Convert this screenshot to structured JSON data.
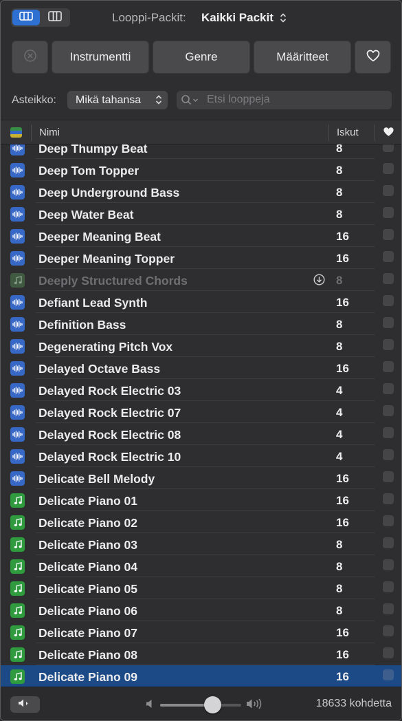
{
  "header": {
    "pack_label": "Looppi-Packit:",
    "pack_value": "Kaikki Packit"
  },
  "filters": {
    "buttons": [
      {
        "label": "Instrumentti"
      },
      {
        "label": "Genre"
      },
      {
        "label": "Määritteet"
      }
    ]
  },
  "scale": {
    "label": "Asteikko:",
    "value": "Mikä tahansa"
  },
  "search": {
    "placeholder": "Etsi looppeja",
    "value": ""
  },
  "table": {
    "columns": {
      "name": "Nimi",
      "beats": "Iskut"
    },
    "rows": [
      {
        "name": "Deep Thumpy Beat",
        "beats": "8",
        "type": "audio"
      },
      {
        "name": "Deep Tom Topper",
        "beats": "8",
        "type": "audio"
      },
      {
        "name": "Deep Underground Bass",
        "beats": "8",
        "type": "audio"
      },
      {
        "name": "Deep Water Beat",
        "beats": "8",
        "type": "audio"
      },
      {
        "name": "Deeper Meaning Beat",
        "beats": "16",
        "type": "audio"
      },
      {
        "name": "Deeper Meaning Topper",
        "beats": "16",
        "type": "audio"
      },
      {
        "name": "Deeply Structured Chords",
        "beats": "8",
        "type": "midi",
        "not_downloaded": true
      },
      {
        "name": "Defiant Lead Synth",
        "beats": "16",
        "type": "audio"
      },
      {
        "name": "Definition Bass",
        "beats": "8",
        "type": "audio"
      },
      {
        "name": "Degenerating Pitch Vox",
        "beats": "8",
        "type": "audio"
      },
      {
        "name": "Delayed Octave Bass",
        "beats": "16",
        "type": "audio"
      },
      {
        "name": "Delayed Rock Electric 03",
        "beats": "4",
        "type": "audio"
      },
      {
        "name": "Delayed Rock Electric 07",
        "beats": "4",
        "type": "audio"
      },
      {
        "name": "Delayed Rock Electric 08",
        "beats": "4",
        "type": "audio"
      },
      {
        "name": "Delayed Rock Electric 10",
        "beats": "4",
        "type": "audio"
      },
      {
        "name": "Delicate Bell Melody",
        "beats": "16",
        "type": "audio"
      },
      {
        "name": "Delicate Piano 01",
        "beats": "16",
        "type": "midi"
      },
      {
        "name": "Delicate Piano 02",
        "beats": "16",
        "type": "midi"
      },
      {
        "name": "Delicate Piano 03",
        "beats": "8",
        "type": "midi"
      },
      {
        "name": "Delicate Piano 04",
        "beats": "8",
        "type": "midi"
      },
      {
        "name": "Delicate Piano 05",
        "beats": "8",
        "type": "midi"
      },
      {
        "name": "Delicate Piano 06",
        "beats": "8",
        "type": "midi"
      },
      {
        "name": "Delicate Piano 07",
        "beats": "16",
        "type": "midi"
      },
      {
        "name": "Delicate Piano 08",
        "beats": "16",
        "type": "midi"
      },
      {
        "name": "Delicate Piano 09",
        "beats": "16",
        "type": "midi",
        "selected": true
      }
    ]
  },
  "footer": {
    "volume_level": 0.65,
    "count_text": "18633 kohdetta"
  },
  "colors": {
    "accent": "#2e6fd2",
    "audio_icon": "#3768c6",
    "midi_icon": "#2f9a3e",
    "selection": "#1c4a86"
  }
}
